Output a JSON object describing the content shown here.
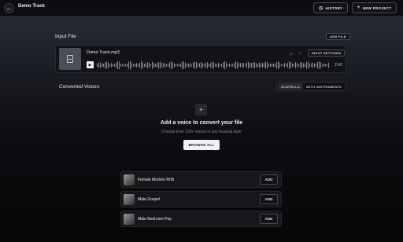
{
  "topbar": {
    "back_icon": "arrow-left-icon",
    "project_title": "Demo Track",
    "history_label": "HISTORY",
    "history_icon": "clock-icon",
    "new_project_label": "NEW PROJECT",
    "new_project_icon": "plus-icon"
  },
  "input_file": {
    "heading": "Input File",
    "add_file_label": "ADD FILE",
    "file_name": "Demo Track.mp3",
    "input_settings_label": "INPUT SETTINGS",
    "duration": "2:42",
    "thumbnail_icon": "audio-file-icon",
    "play_icon": "play-icon",
    "warning_icon": "warning-icon",
    "delete_icon": "trash-icon"
  },
  "converted": {
    "heading": "Converted Voices",
    "tabs": [
      {
        "label": "ACAPELLA",
        "active": true
      },
      {
        "label": "WITH INSTRUMENTS",
        "active": false
      }
    ],
    "empty_title": "Add a voice to convert your file",
    "empty_subtitle": "Choose from 100+ voices in any musical style",
    "browse_label": "BROWSE ALL"
  },
  "voices": [
    {
      "name": "Female Modern RnB",
      "add_label": "ADD"
    },
    {
      "name": "Male Gospel",
      "add_label": "ADD"
    },
    {
      "name": "Male Bedroom Pop",
      "add_label": "ADD"
    }
  ],
  "colors": {
    "background_top": "#2b2f3a",
    "background_bottom": "#060607",
    "accent_light": "#f2f2f2"
  }
}
